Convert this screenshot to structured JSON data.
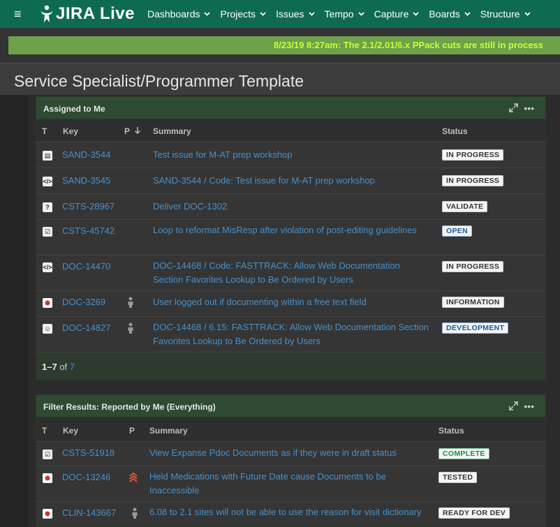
{
  "nav": {
    "logo_text": "JIRA Live",
    "items": [
      "Dashboards",
      "Projects",
      "Issues",
      "Tempo",
      "Capture",
      "Boards",
      "Structure"
    ]
  },
  "announcement": "8/23/19 8:27am: The 2.1/2.01/6.x PPack cuts are still in process",
  "page_title": "Service Specialist/Programmer Template",
  "gadget1": {
    "title": "Assigned to Me",
    "columns": {
      "t": "T",
      "key": "Key",
      "p": "P",
      "summary": "Summary",
      "status": "Status"
    },
    "rows": [
      {
        "icon": "story-icon",
        "key": "SAND-3544",
        "prio": "",
        "summary": "Test issue for M-AT prep workshop",
        "status": "IN PROGRESS",
        "style": ""
      },
      {
        "icon": "code-icon",
        "key": "SAND-3545",
        "prio": "",
        "summary": "SAND-3544 /  Code: Test issue for M-AT prep workshop",
        "status": "IN PROGRESS",
        "style": ""
      },
      {
        "icon": "question-icon",
        "key": "CSTS-28967",
        "prio": "",
        "summary": "Deliver DOC-1302",
        "status": "VALIDATE",
        "style": ""
      },
      {
        "icon": "task-icon",
        "key": "CSTS-45742",
        "prio": "",
        "summary": "Loop to reformat MisResp after violation of post-editing guidelines",
        "status": "OPEN",
        "style": "blue"
      },
      {
        "icon": "code-icon",
        "key": "DOC-14470",
        "prio": "",
        "summary": "DOC-14468 /  Code: FASTTRACK: Allow Web Documentation Section Favorites Lookup to Be Ordered by Users",
        "status": "IN PROGRESS",
        "style": ""
      },
      {
        "icon": "bug-icon",
        "key": "DOC-3269",
        "prio": "person",
        "summary": "User logged out if documenting within a free text field",
        "status": "INFORMATION",
        "style": ""
      },
      {
        "icon": "smile-icon",
        "key": "DOC-14827",
        "prio": "person",
        "summary": "DOC-14468 /  6.15: FASTTRACK: Allow Web Documentation Section Favorites Lookup to Be Ordered by Users",
        "status": "DEVELOPMENT",
        "style": "blue"
      }
    ],
    "pager_range": "1–7",
    "pager_of": "of",
    "pager_total": "7"
  },
  "gadget2": {
    "title": "Filter Results: Reported by Me (Everything)",
    "columns": {
      "t": "T",
      "key": "Key",
      "p": "P",
      "summary": "Summary",
      "status": "Status"
    },
    "rows": [
      {
        "icon": "task-icon",
        "key": "CSTS-51918",
        "prio": "",
        "summary": "View Expanse Pdoc Documents as if they were in draft status",
        "status": "COMPLETE",
        "style": "green"
      },
      {
        "icon": "bug-icon",
        "key": "DOC-13246",
        "prio": "highest",
        "summary": "Held Medications with Future Date cause Documents to be Inaccessible",
        "status": "TESTED",
        "style": ""
      },
      {
        "icon": "bug-icon",
        "key": "CLIN-143667",
        "prio": "person",
        "summary": "6.08 to 2.1 sites will not be able to use the reason for visit dictionary",
        "status": "READY FOR DEV",
        "style": ""
      }
    ]
  },
  "colors": {
    "nav_bg": "#0f6b4f",
    "gadget_head": "#2e4a31",
    "link": "#4a90c8",
    "announce_text": "#c8ff3a"
  }
}
